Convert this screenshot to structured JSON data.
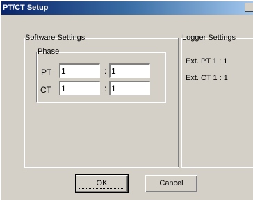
{
  "window": {
    "title": "PT/CT Setup"
  },
  "software_settings": {
    "legend": "Software Settings",
    "phase": {
      "legend": "Phase",
      "pt": {
        "label": "PT",
        "value_left": "1",
        "separator": ":",
        "value_right": "1"
      },
      "ct": {
        "label": "CT",
        "value_left": "1",
        "separator": ":",
        "value_right": "1"
      }
    }
  },
  "logger_settings": {
    "legend": "Logger Settings",
    "ext_pt": "Ext. PT 1 : 1",
    "ext_ct": "Ext. CT 1 : 1"
  },
  "buttons": {
    "ok": "OK",
    "cancel": "Cancel"
  },
  "colors": {
    "title_bar_start": "#0a246a",
    "title_bar_end": "#a6caf0",
    "dialog_face": "#d4d0c8"
  }
}
